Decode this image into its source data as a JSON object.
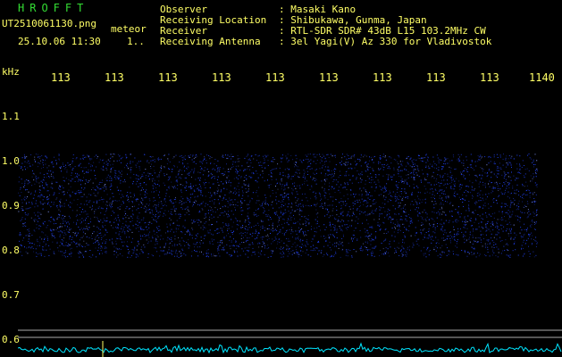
{
  "app": {
    "title": "HROFFT"
  },
  "file": {
    "name": "UT2510061130.png",
    "meteor_label": "meteor",
    "timestamp": "25.10.06 11:30",
    "counter": "1.."
  },
  "info": [
    {
      "label": "Observer",
      "value": ": Masaki Kano"
    },
    {
      "label": "Receiving Location",
      "value": ": Shibukawa, Gunma, Japan"
    },
    {
      "label": "Receiver",
      "value": ": RTL-SDR SDR# 43dB L15 103.2MHz CW"
    },
    {
      "label": "Receiving Antenna",
      "value": ": 3el Yagi(V) Az 330 for Vladivostok"
    }
  ],
  "axis": {
    "unit": "kHz",
    "time_ticks": [
      "113",
      "113",
      "113",
      "113",
      "113",
      "113",
      "113",
      "113",
      "113",
      "1140"
    ],
    "freq_ticks": [
      "1.1",
      "1.0",
      "0.9",
      "0.8",
      "0.7",
      "0.6"
    ]
  },
  "colors": {
    "title": "#33dd33",
    "text": "#ffff66",
    "signal": "#2244ff",
    "spectrum": "#00e5ff",
    "ref_line": "#bbbbbb"
  },
  "spectrogram": {
    "band_khz": [
      0.8,
      1.0
    ],
    "noise_blocks": [
      {
        "start_min": 1130.0,
        "end_min": 1130.9
      },
      {
        "start_min": 1131.0,
        "end_min": 1131.9
      },
      {
        "start_min": 1132.0,
        "end_min": 1132.9
      },
      {
        "start_min": 1133.0,
        "end_min": 1133.9
      },
      {
        "start_min": 1134.0,
        "end_min": 1134.9
      },
      {
        "start_min": 1135.0,
        "end_min": 1135.9
      },
      {
        "start_min": 1136.0,
        "end_min": 1136.9
      },
      {
        "start_min": 1137.0,
        "end_min": 1137.9
      },
      {
        "start_min": 1138.0,
        "end_min": 1138.9
      },
      {
        "start_min": 1139.0,
        "end_min": 1139.9
      }
    ]
  }
}
